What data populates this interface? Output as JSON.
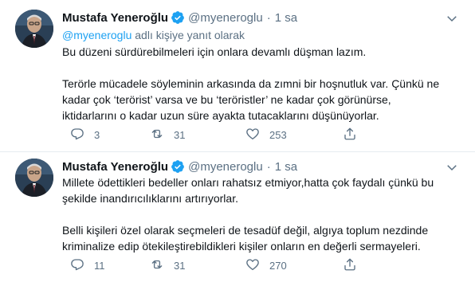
{
  "tweets": [
    {
      "author_name": "Mustafa Yeneroğlu",
      "handle": "@myeneroglu",
      "separator": "·",
      "time": "1 sa",
      "reply_mention": "@myeneroglu",
      "reply_suffix": "adlı kişiye yanıt olarak",
      "lines": [
        "Bu düzeni sürdürebilmeleri için onlara devamlı düşman lazım.",
        "Terörle mücadele söyleminin arkasında da zımni bir hoşnutluk var. Çünkü ne",
        "kadar çok ‘terörist’ varsa ve bu ‘teröristler’ ne kadar çok görünürse,",
        "iktidarlarını o kadar uzun süre ayakta tutacaklarını düşünüyorlar."
      ],
      "replies": "3",
      "retweets": "31",
      "likes": "253"
    },
    {
      "author_name": "Mustafa Yeneroğlu",
      "handle": "@myeneroglu",
      "separator": "·",
      "time": "1 sa",
      "lines": [
        "Millete ödettikleri bedeller onları rahatsız etmiyor,hatta çok faydalı çünkü bu",
        "şekilde inandırıcılıklarını artırıyorlar.",
        "Belli kişileri özel olarak seçmeleri de tesadüf değil, algıya toplum nezdinde",
        "kriminalize edip ötekileştirebildikleri kişiler onların en değerli sermayeleri."
      ],
      "replies": "11",
      "retweets": "31",
      "likes": "270"
    }
  ],
  "icons": {
    "verified": "verified-badge-icon",
    "more": "chevron-down-icon",
    "reply": "reply-icon",
    "retweet": "retweet-icon",
    "like": "heart-icon",
    "share": "share-icon"
  },
  "colors": {
    "primary_text": "#0f1419",
    "secondary_text": "#5b7083",
    "link": "#1da1f2",
    "divider": "#e6ecf0"
  }
}
